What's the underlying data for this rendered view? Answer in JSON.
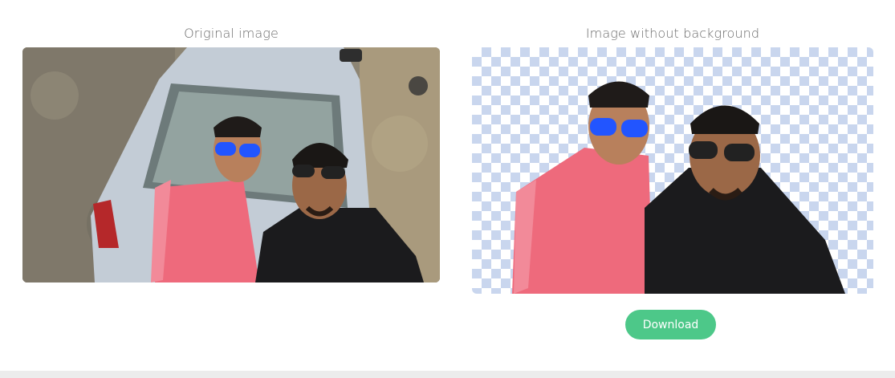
{
  "original_panel": {
    "title": "Original image",
    "image_description_icon": "photo-icon"
  },
  "result_panel": {
    "title": "Image without background",
    "transparency_pattern_color": "#c9d6ee"
  },
  "download": {
    "label": "Download",
    "color": "#4dc889"
  }
}
